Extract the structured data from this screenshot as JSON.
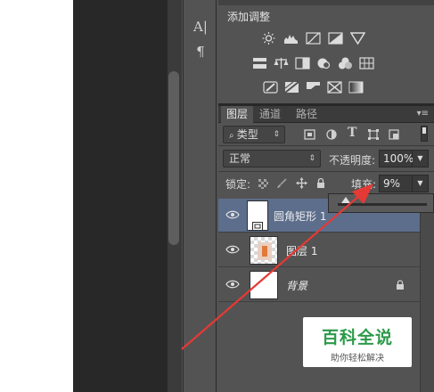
{
  "colors": {
    "panel_bg": "#535353",
    "selected_row": "#5c6e8c",
    "arrow_red": "#e53935",
    "watermark_green": "#2c9a4a"
  },
  "tools": {
    "items": [
      {
        "icon": "character-panel-icon",
        "glyph": "A|"
      },
      {
        "icon": "paragraph-panel-icon",
        "glyph": "¶"
      }
    ]
  },
  "adjustments": {
    "title": "添加调整",
    "icons": [
      "brightness-contrast-icon",
      "levels-icon",
      "curves-icon",
      "exposure-icon",
      "vibrance-icon",
      "hue-saturation-icon",
      "color-balance-icon",
      "black-white-icon",
      "photo-filter-icon",
      "channel-mixer-icon",
      "color-lookup-icon",
      "invert-icon",
      "posterize-icon",
      "threshold-icon",
      "selective-color-icon",
      "gradient-map-icon"
    ]
  },
  "layers_panel": {
    "tabs": [
      {
        "label": "图层",
        "active": true
      },
      {
        "label": "通道",
        "active": false
      },
      {
        "label": "路径",
        "active": false
      }
    ],
    "filter": {
      "label": "类型"
    },
    "blend_mode": "正常",
    "opacity_label": "不透明度:",
    "opacity_value": "100%",
    "lock_label": "锁定:",
    "fill_label": "填充:",
    "fill_value": "9%",
    "fill_slider_fraction": 0.09,
    "layers": [
      {
        "name": "圆角矩形 1",
        "selected": true,
        "thumb": "rounded-rect"
      },
      {
        "name": "图层 1",
        "selected": false,
        "thumb": "image"
      },
      {
        "name": "背景",
        "selected": false,
        "thumb": "white",
        "locked": true
      }
    ]
  },
  "watermark": {
    "title": "百科全说",
    "subtitle": "助你轻松解决"
  }
}
